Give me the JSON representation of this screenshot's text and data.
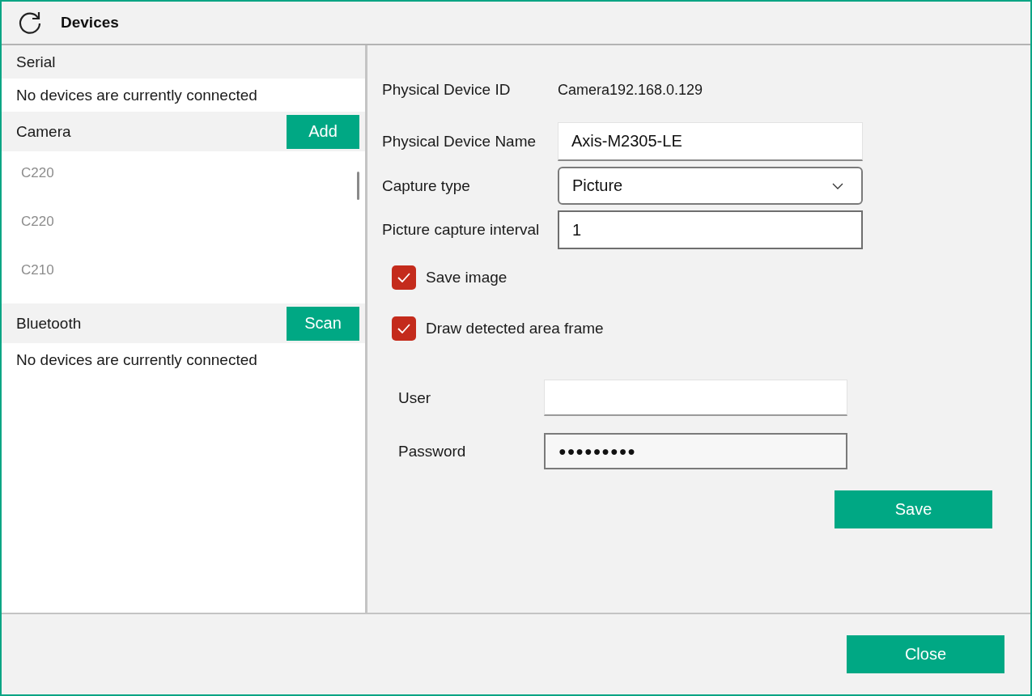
{
  "window": {
    "title": "Devices"
  },
  "sections": [
    {
      "title": "Serial",
      "empty_text": "No devices are currently connected"
    },
    {
      "title": "Camera",
      "button": "Add",
      "items": [
        "C220",
        "C220",
        "C210"
      ]
    },
    {
      "title": "Bluetooth",
      "button": "Scan",
      "empty_text": "No devices are currently connected"
    }
  ],
  "details": {
    "device_id": {
      "label": "Physical Device ID",
      "value": "Camera192.168.0.129"
    },
    "device_name": {
      "label": "Physical Device Name",
      "value": "Axis-M2305-LE"
    },
    "capture_type": {
      "label": "Capture type",
      "value": "Picture"
    },
    "interval": {
      "label": "Picture capture interval",
      "value": "1"
    },
    "checkboxes": [
      {
        "label": "Save image",
        "checked": true
      },
      {
        "label": "Draw detected area frame",
        "checked": true
      }
    ],
    "user": {
      "label": "User"
    },
    "password": {
      "label": "Password",
      "value": "●●●●●●●●●"
    },
    "save_button": "Save"
  },
  "footer": {
    "close_button": "Close"
  }
}
